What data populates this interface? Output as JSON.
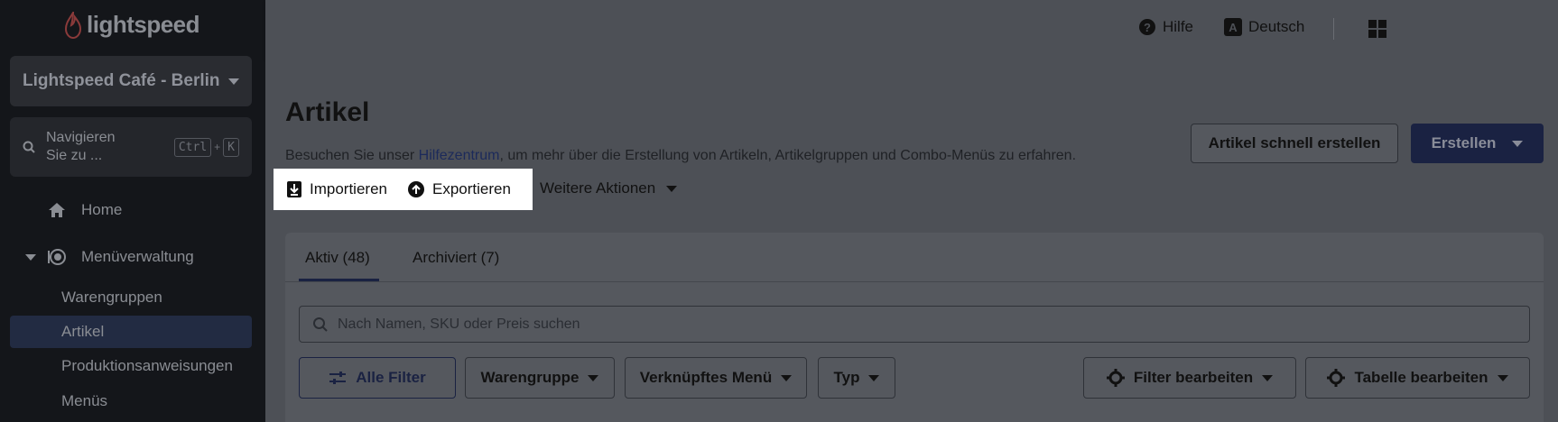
{
  "app": {
    "logo_text": "lightspeed"
  },
  "sidebar": {
    "store_name": "Lightspeed Café - Berlin",
    "search_label": "Navigieren Sie zu ...",
    "shortcut_keys": [
      "Ctrl",
      "K"
    ],
    "shortcut_plus": "+",
    "items": [
      {
        "label": "Home",
        "icon": "home-icon"
      },
      {
        "label": "Menüverwaltung",
        "icon": "menu-management-icon"
      }
    ],
    "sub_items": [
      {
        "label": "Warengruppen"
      },
      {
        "label": "Artikel",
        "active": true
      },
      {
        "label": "Produktionsanweisungen"
      },
      {
        "label": "Menüs"
      }
    ]
  },
  "topbar": {
    "help_label": "Hilfe",
    "language_label": "Deutsch",
    "language_badge": "A"
  },
  "page": {
    "title": "Artikel",
    "help_prefix": "Besuchen Sie unser ",
    "help_link": "Hilfezentrum",
    "help_suffix": ", um mehr über die Erstellung von Artikeln, Artikelgruppen und Combo-Menüs zu erfahren.",
    "quick_create_label": "Artikel schnell erstellen",
    "create_label": "Erstellen",
    "import_label": "Importieren",
    "export_label": "Exportieren",
    "more_actions_label": "Weitere Aktionen"
  },
  "tabs": [
    {
      "label": "Aktiv (48)",
      "active": true
    },
    {
      "label": "Archiviert (7)"
    }
  ],
  "search": {
    "placeholder": "Nach Namen, SKU oder Preis suchen"
  },
  "filters": {
    "all_filters": "Alle Filter",
    "category": "Warengruppe",
    "linked_menu": "Verknüpftes Menü",
    "type": "Typ",
    "edit_filters": "Filter bearbeiten",
    "edit_table": "Tabelle bearbeiten"
  },
  "colors": {
    "sidebar_bg": "#14161a",
    "overlay": "#4d5056",
    "primary": "#1a2242",
    "highlight": "#ffffff"
  }
}
